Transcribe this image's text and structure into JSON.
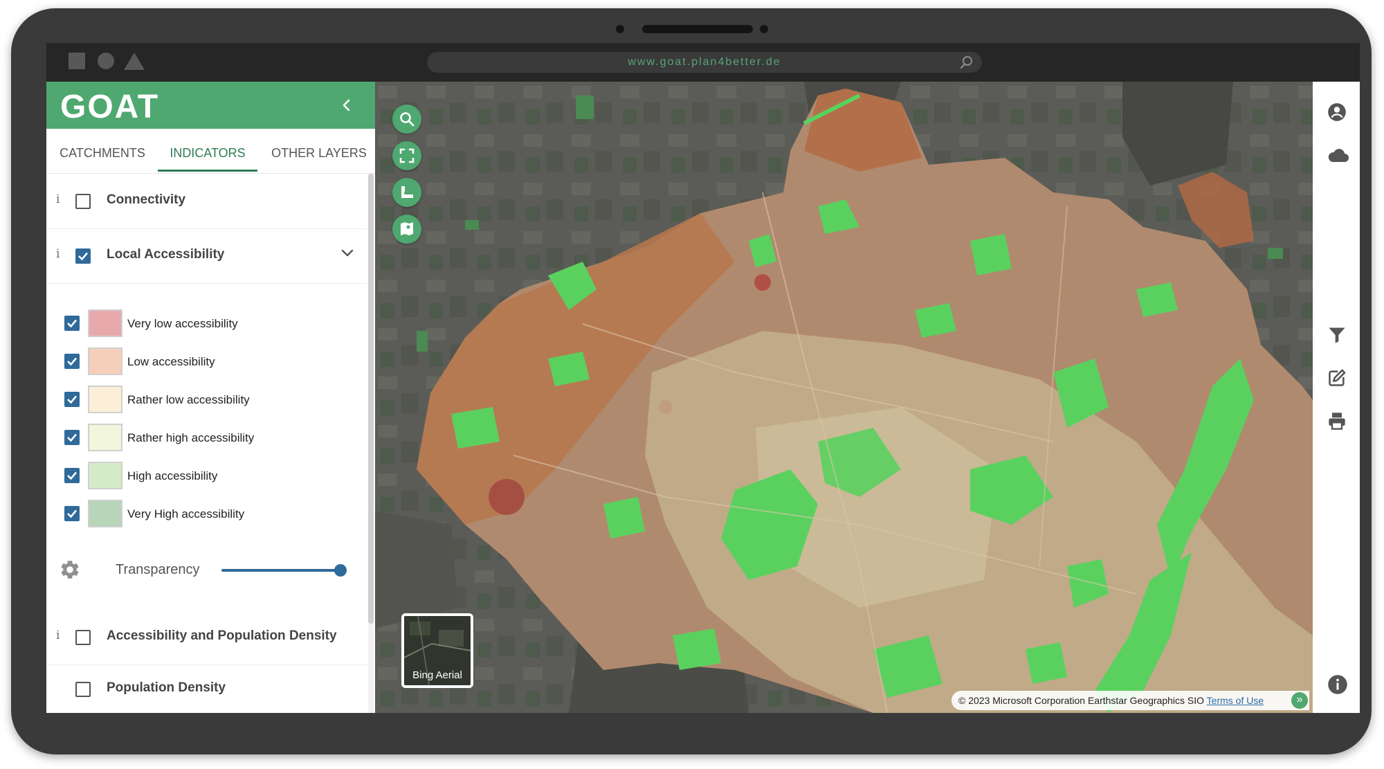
{
  "browser": {
    "url": "www.goat.plan4better.de"
  },
  "app": {
    "logo_text": "GOAT"
  },
  "colors": {
    "brand_green": "#4fa870",
    "tab_active": "#2e7d56",
    "checkbox_blue": "#2f6a9a",
    "bright_green": "#5ad15f"
  },
  "tabs": [
    {
      "label": "CATCHMENTS",
      "active": false
    },
    {
      "label": "INDICATORS",
      "active": true
    },
    {
      "label": "OTHER LAYERS",
      "active": false
    }
  ],
  "layers": {
    "connectivity": {
      "label": "Connectivity",
      "checked": false
    },
    "local_accessibility": {
      "label": "Local Accessibility",
      "checked": true,
      "expanded": true,
      "legend": [
        {
          "label": "Very low accessibility",
          "color": "#e8a9aa",
          "checked": true
        },
        {
          "label": "Low accessibility",
          "color": "#f6cfbb",
          "checked": true
        },
        {
          "label": "Rather low accessibility",
          "color": "#fdeed7",
          "checked": true
        },
        {
          "label": "Rather high accessibility",
          "color": "#f1f6dd",
          "checked": true
        },
        {
          "label": "High accessibility",
          "color": "#d5ebc8",
          "checked": true
        },
        {
          "label": "Very High accessibility",
          "color": "#b7d6b9",
          "checked": true
        }
      ],
      "transparency": {
        "label": "Transparency",
        "value": 1.0
      }
    },
    "accessibility_population": {
      "label": "Accessibility and Population Density",
      "checked": false
    },
    "population_density": {
      "label": "Population Density",
      "checked": false
    }
  },
  "map": {
    "basemap_label": "Bing Aerial",
    "attribution": {
      "text": "© 2023 Microsoft Corporation Earthstar Geographics SIO",
      "link": "Terms of Use",
      "expand_glyph": "»"
    }
  },
  "icons": {
    "map_tools": [
      "search-icon",
      "fullscreen-icon",
      "measure-icon",
      "map-layers-icon"
    ],
    "right_bar": [
      "user-icon",
      "cloud-icon",
      "filter-icon",
      "edit-icon",
      "print-icon",
      "info-icon"
    ]
  }
}
